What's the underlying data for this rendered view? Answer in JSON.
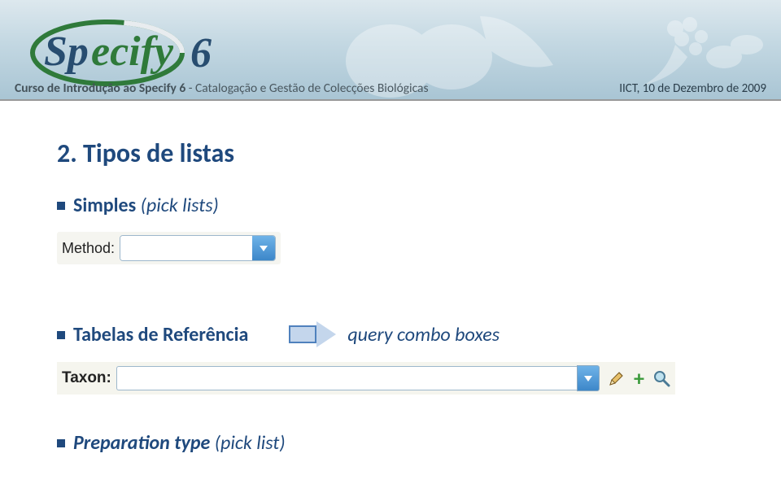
{
  "header": {
    "logo_text_1": "Sp",
    "logo_text_2": "ecify",
    "logo_text_3": "6",
    "subtitle_bold": "Curso de Introdução ao Specify 6",
    "subtitle_rest": " - Catalogação e Gestão de Colecções Biológicas",
    "right": "IICT, 10 de Dezembro de 2009"
  },
  "section": {
    "title": "2. Tipos de listas"
  },
  "bullets": {
    "simples_bold": "Simples",
    "simples_ital": "(pick lists)",
    "tabelas": "Tabelas de Referência",
    "query": "query combo boxes",
    "prep_bold": "Preparation type",
    "prep_ital": "  (pick list)"
  },
  "fields": {
    "method_label": "Method:",
    "method_value": "",
    "taxon_label": "Taxon:",
    "taxon_value": ""
  },
  "icons": {
    "dropdown": "dropdown-icon",
    "edit": "pencil-icon",
    "add": "plus-icon",
    "search": "magnifier-icon"
  }
}
